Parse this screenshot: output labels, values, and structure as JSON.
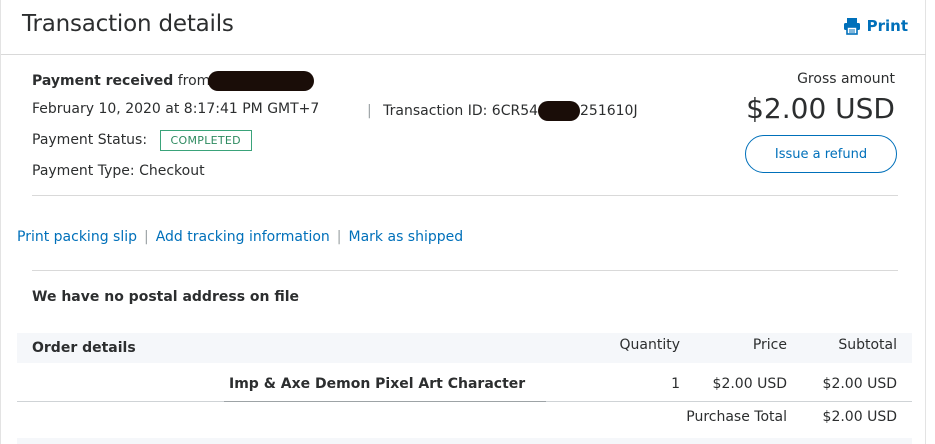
{
  "header": {
    "title": "Transaction details",
    "print_label": "Print"
  },
  "summary": {
    "payment_received_label": "Payment received",
    "from_label": "from",
    "date": "February 10, 2020 at 8:17:41 PM GMT+7",
    "separator": "|",
    "transaction_id_label": "Transaction ID: 6CR54",
    "transaction_id_suffix": "251610J",
    "payment_status_label": "Payment Status:",
    "payment_status_value": "COMPLETED",
    "payment_type": "Payment Type: Checkout",
    "gross_label": "Gross amount",
    "gross_amount": "$2.00 USD",
    "refund_button": "Issue a refund"
  },
  "actions": {
    "print_packing_slip": "Print packing slip",
    "add_tracking": "Add tracking information",
    "mark_shipped": "Mark as shipped",
    "separator": "|"
  },
  "shipping": {
    "postal_notice": "We have no postal address on file"
  },
  "order": {
    "header": {
      "title": "Order details",
      "quantity": "Quantity",
      "price": "Price",
      "subtotal": "Subtotal"
    },
    "items": [
      {
        "name": "Imp & Axe Demon Pixel Art Character",
        "quantity": "1",
        "price": "$2.00 USD",
        "subtotal": "$2.00 USD"
      }
    ],
    "purchase_total_label": "Purchase Total",
    "purchase_total_value": "$2.00 USD"
  },
  "colors": {
    "link": "#0070ba",
    "status_green": "#2e8a60",
    "redaction": "#1a0d08"
  },
  "icons": {
    "print": "printer-icon"
  }
}
